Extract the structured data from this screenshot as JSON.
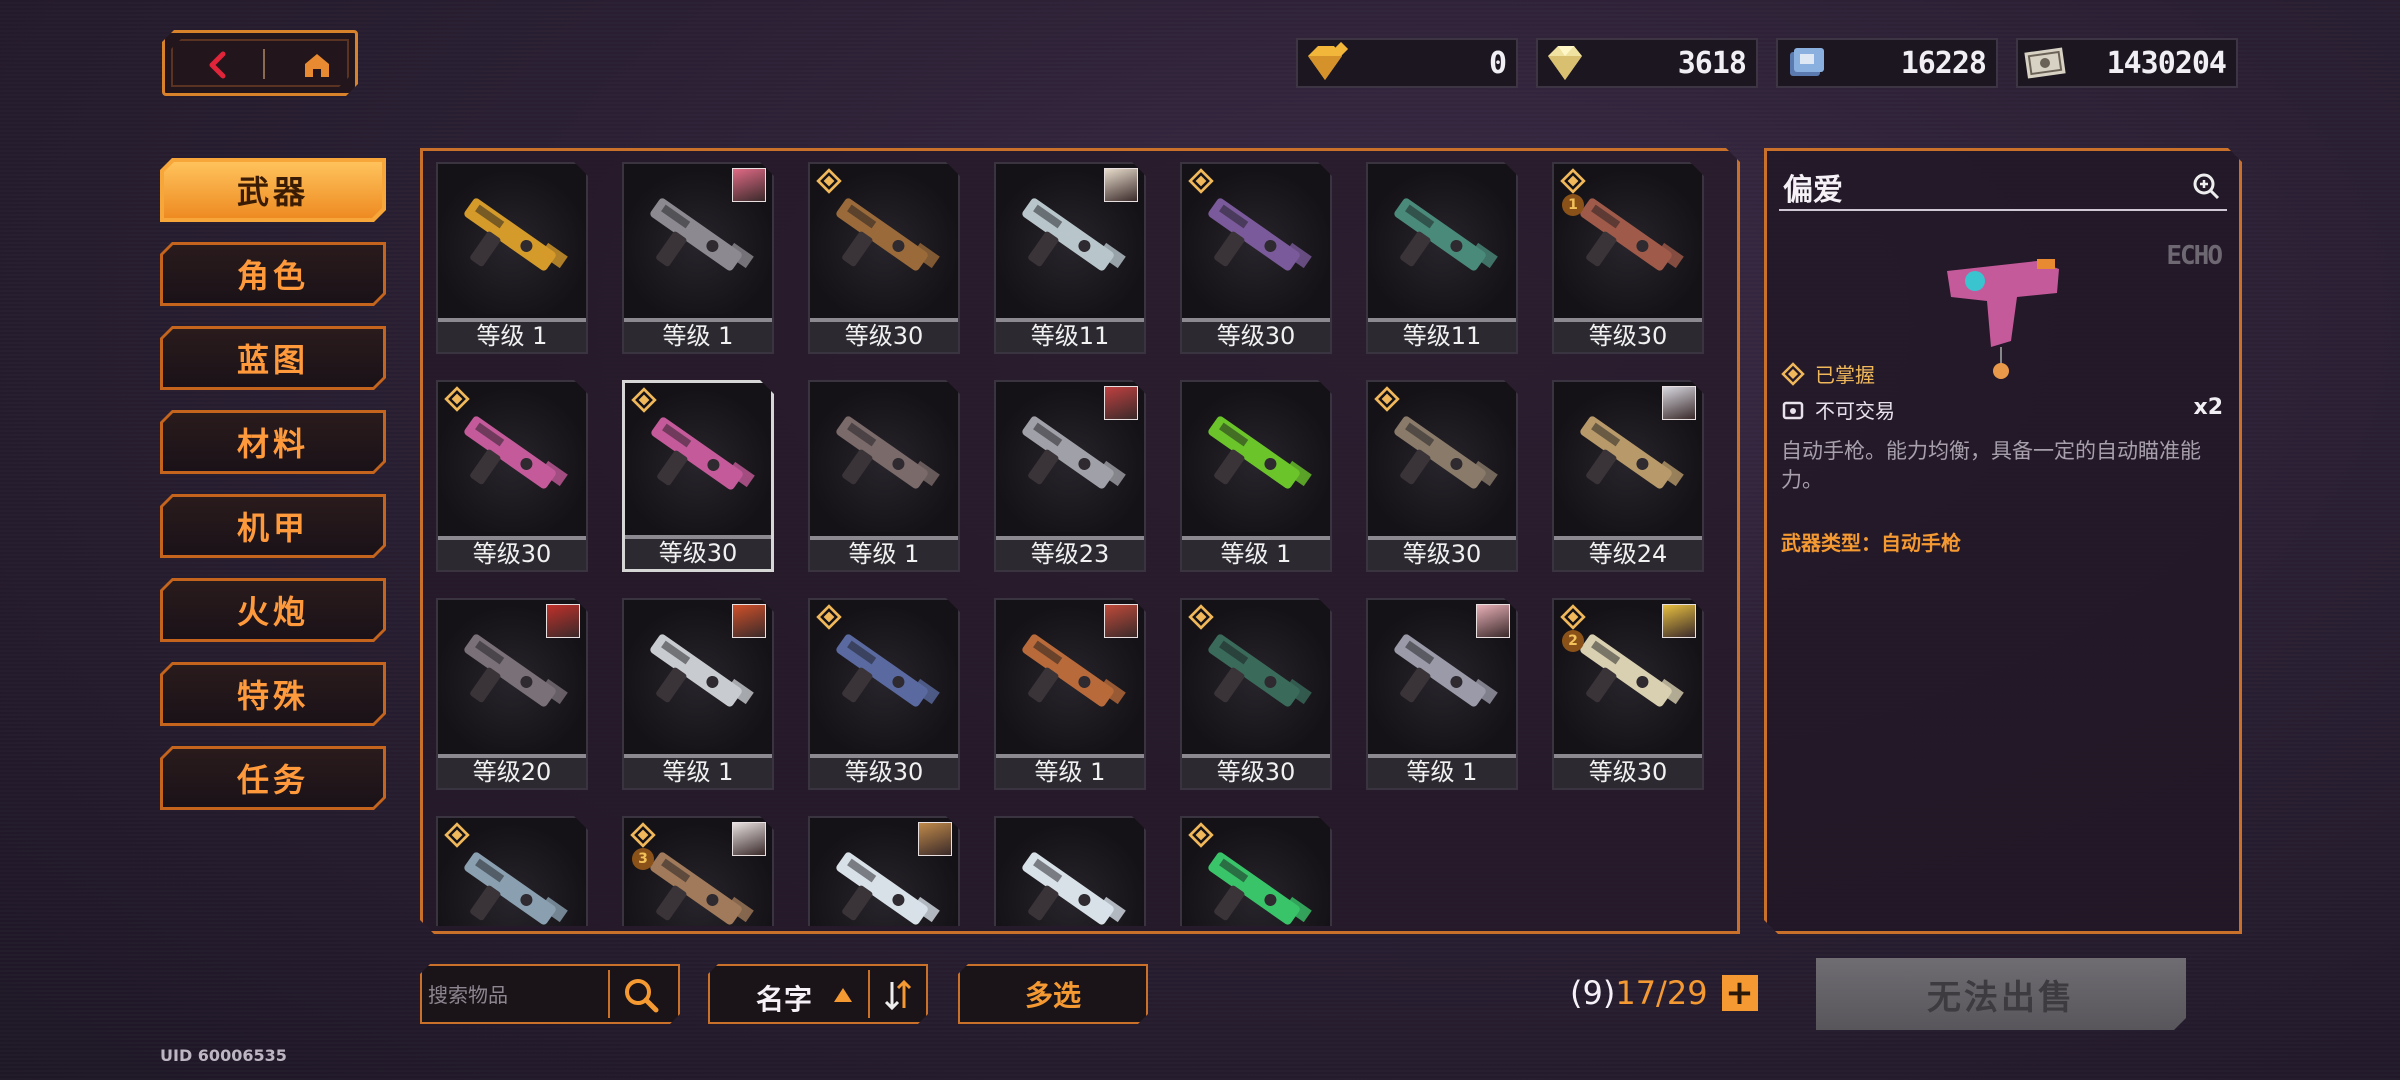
{
  "nav": {
    "back_icon": "back-arrow-icon",
    "home_icon": "home-icon"
  },
  "currencies": [
    {
      "name": "gold-gem",
      "value": "0"
    },
    {
      "name": "blue-gem",
      "value": "3618"
    },
    {
      "name": "chip",
      "value": "16228"
    },
    {
      "name": "cash",
      "value": "1430204"
    }
  ],
  "sidebar": {
    "items": [
      {
        "label": "武器",
        "active": true
      },
      {
        "label": "角色"
      },
      {
        "label": "蓝图"
      },
      {
        "label": "材料"
      },
      {
        "label": "机甲"
      },
      {
        "label": "火炮"
      },
      {
        "label": "特殊"
      },
      {
        "label": "任务"
      }
    ]
  },
  "grid": {
    "items": [
      {
        "level": "等级 1",
        "color": "#d49a2a",
        "mark": false,
        "avatar": null
      },
      {
        "level": "等级 1",
        "color": "#8c8a90",
        "mark": false,
        "avatar": "#e06a86"
      },
      {
        "level": "等级30",
        "color": "#9a6a3a",
        "mark": true,
        "avatar": null
      },
      {
        "level": "等级11",
        "color": "#b8c6cc",
        "mark": false,
        "avatar": "#e8dccc"
      },
      {
        "level": "等级30",
        "color": "#7a5a9a",
        "mark": true,
        "avatar": null
      },
      {
        "level": "等级11",
        "color": "#4a8a7a",
        "mark": false,
        "avatar": null
      },
      {
        "level": "等级30",
        "color": "#a05a4a",
        "mark": true,
        "avatar": null,
        "rank": "1"
      },
      {
        "level": "等级30",
        "color": "#c45a9a",
        "mark": true,
        "avatar": null
      },
      {
        "level": "等级30",
        "color": "#c45a9a",
        "mark": true,
        "avatar": null,
        "selected": true
      },
      {
        "level": "等级 1",
        "color": "#7a6a6a",
        "mark": false,
        "avatar": null
      },
      {
        "level": "等级23",
        "color": "#a0a0a8",
        "mark": false,
        "avatar": "#c04040"
      },
      {
        "level": "等级 1",
        "color": "#6ac42a",
        "mark": false,
        "avatar": null
      },
      {
        "level": "等级30",
        "color": "#8a7a6a",
        "mark": true,
        "avatar": null
      },
      {
        "level": "等级24",
        "color": "#b89a6a",
        "mark": false,
        "avatar": "#d8d8e0"
      },
      {
        "level": "等级20",
        "color": "#7a7078",
        "mark": false,
        "avatar": "#c0302a"
      },
      {
        "level": "等级 1",
        "color": "#c8ccd0",
        "mark": false,
        "avatar": "#d0502a"
      },
      {
        "level": "等级30",
        "color": "#5a6aa0",
        "mark": true,
        "avatar": null
      },
      {
        "level": "等级 1",
        "color": "#b86a3a",
        "mark": false,
        "avatar": "#c04a3a"
      },
      {
        "level": "等级30",
        "color": "#3a6a5a",
        "mark": true,
        "avatar": null
      },
      {
        "level": "等级 1",
        "color": "#9a9aa8",
        "mark": false,
        "avatar": "#e8b0b8"
      },
      {
        "level": "等级30",
        "color": "#d8d0b0",
        "mark": true,
        "avatar": "#e8c040",
        "rank": "2"
      },
      {
        "level": "",
        "color": "#8aa0b0",
        "mark": true,
        "avatar": null
      },
      {
        "level": "",
        "color": "#a07a5a",
        "mark": true,
        "avatar": "#e8e0e0",
        "rank": "3"
      },
      {
        "level": "",
        "color": "#d8e0e8",
        "mark": false,
        "avatar": "#c08a4a"
      },
      {
        "level": "",
        "color": "#d8e0e8",
        "mark": false,
        "avatar": null
      },
      {
        "level": "",
        "color": "#3ac46a",
        "mark": true,
        "avatar": null
      }
    ]
  },
  "detail": {
    "title": "偏爱",
    "brand": "ECHO",
    "mastered": "已掌握",
    "tradable": "不可交易",
    "count": "x2",
    "description": "自动手枪。能力均衡，具备一定的自动瞄准能力。",
    "type_label": "武器类型：自动手枪"
  },
  "bottom": {
    "search_placeholder": "搜索物品",
    "sort_label": "名字",
    "multi_label": "多选",
    "capacity_a": "(9)",
    "capacity_b": "17/29",
    "plus": "+",
    "sell_label": "无法出售"
  },
  "uid": "UID 60006535",
  "colors": {
    "accent": "#f59a32",
    "border": "#c9702a"
  }
}
